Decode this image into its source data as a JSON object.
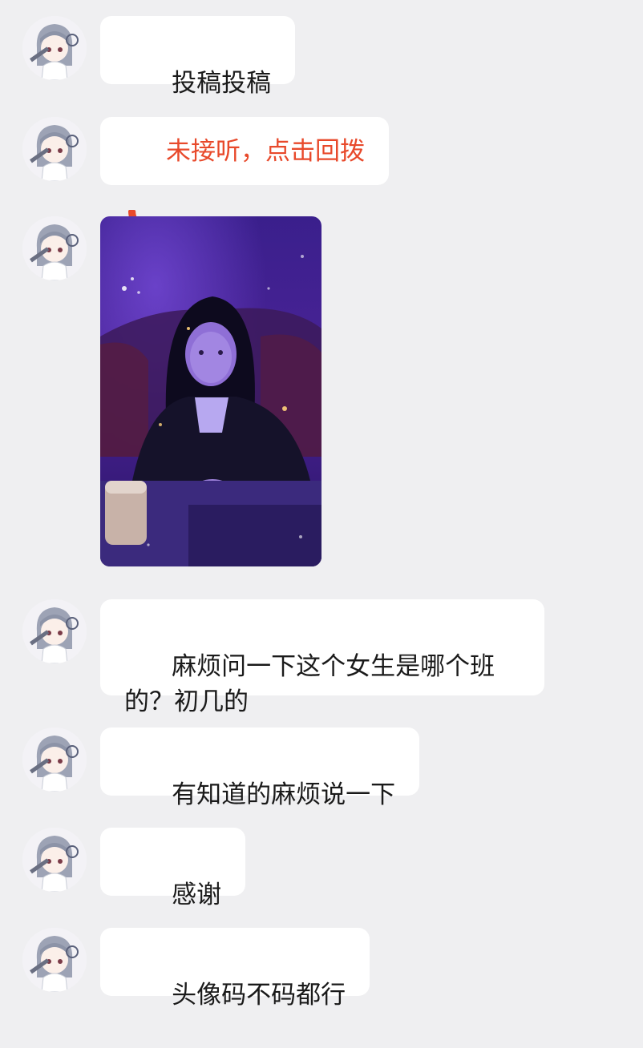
{
  "messages": [
    {
      "type": "text",
      "text": "投稿投稿"
    },
    {
      "type": "call",
      "text": "未接听，点击回拨",
      "icon": "phone-icon",
      "color": "#e8492b"
    },
    {
      "type": "image",
      "description_icon": "photo"
    },
    {
      "type": "text",
      "text": "麻烦问一下这个女生是哪个班\n的？初几的"
    },
    {
      "type": "text",
      "text": "有知道的麻烦说一下"
    },
    {
      "type": "text",
      "text": "感谢"
    },
    {
      "type": "text",
      "text": "头像码不码都行"
    }
  ],
  "colors": {
    "background": "#efeff1",
    "bubble": "#ffffff",
    "missed_call": "#e8492b"
  }
}
